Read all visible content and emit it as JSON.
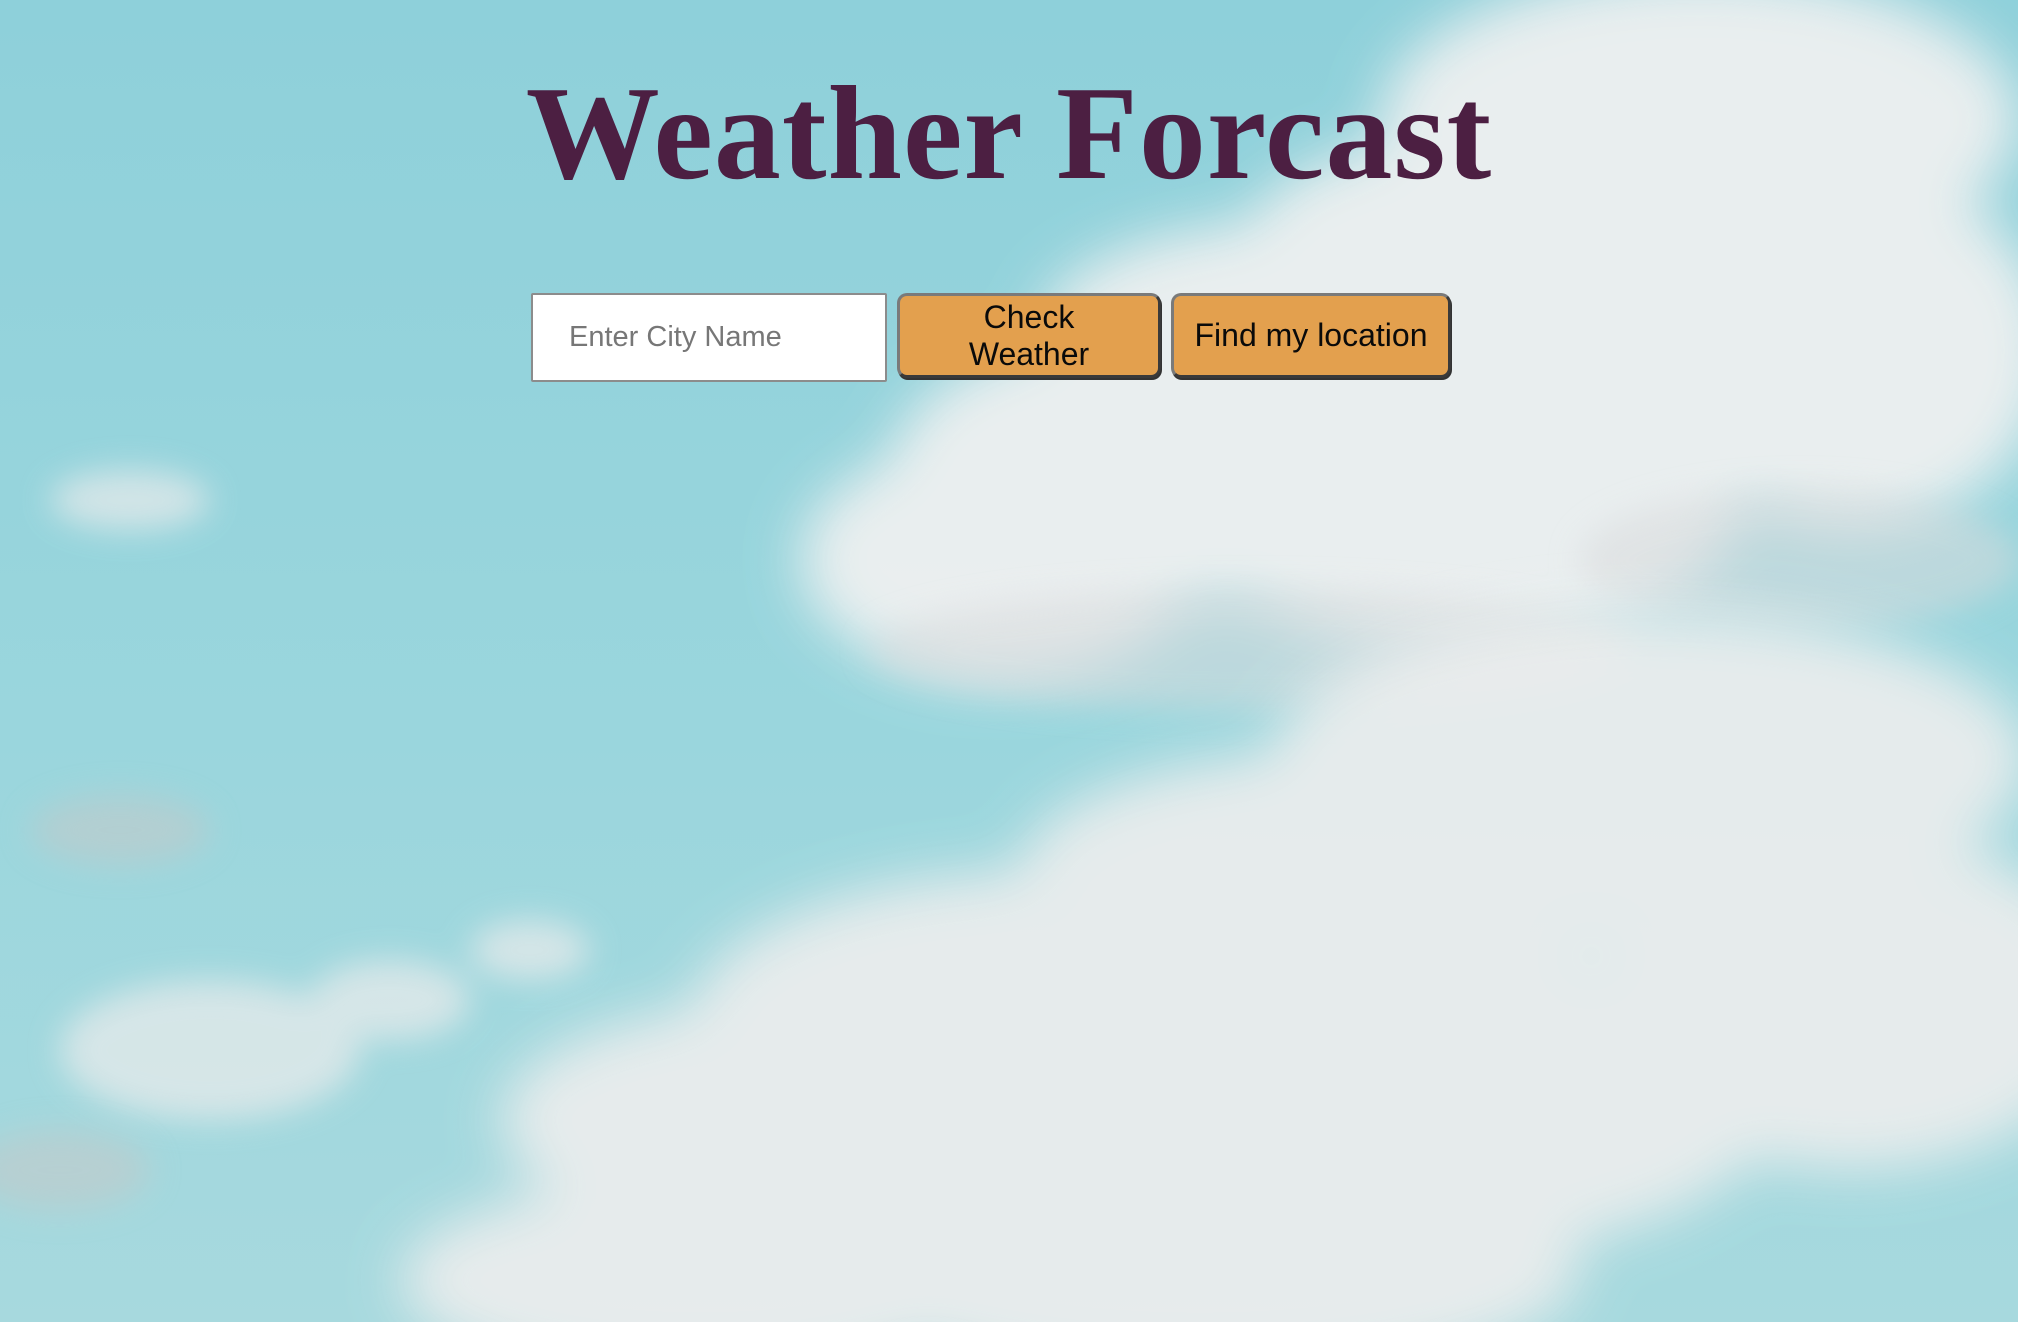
{
  "header": {
    "title": "Weather Forcast"
  },
  "search": {
    "placeholder": "Enter City Name",
    "value": ""
  },
  "actions": {
    "check_weather_label": "Check Weather",
    "find_location_label": "Find my location"
  },
  "colors": {
    "title": "#4c1f42",
    "button": "#e3a04e",
    "sky": "#93d3db",
    "cloud": "#eef0f0"
  }
}
